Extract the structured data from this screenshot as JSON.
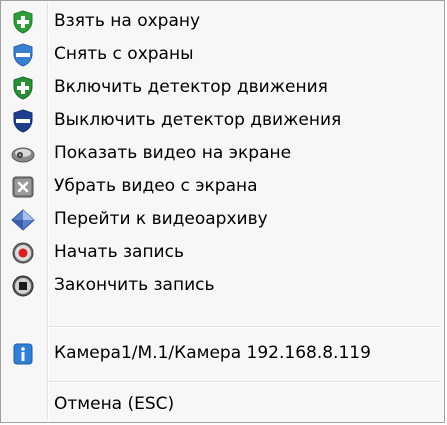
{
  "context_menu": {
    "items": [
      {
        "label": "Взять на охрану",
        "icon": "shield-green-plus-icon"
      },
      {
        "label": "Снять с охраны",
        "icon": "shield-blue-minus-icon"
      },
      {
        "label": "Включить детектор движения",
        "icon": "shield-green-plus-icon"
      },
      {
        "label": "Выключить детектор движения",
        "icon": "shield-navy-minus-icon"
      },
      {
        "label": "Показать видео на экране",
        "icon": "camera-icon"
      },
      {
        "label": "Убрать видео с экрана",
        "icon": "close-box-icon"
      },
      {
        "label": "Перейти к видеоархиву",
        "icon": "archive-diamond-icon"
      },
      {
        "label": "Начать запись",
        "icon": "record-icon"
      },
      {
        "label": "Закончить запись",
        "icon": "stop-icon"
      }
    ],
    "info_item": {
      "label": "Камера1/М.1/Камера 192.168.8.119",
      "icon": "info-icon"
    },
    "cancel_item": {
      "label": "Отмена (ESC)"
    }
  },
  "colors": {
    "shield_green": "#2e9e3a",
    "shield_blue": "#3a7fd0",
    "shield_navy": "#1e3f8f",
    "info_blue": "#2f7fd6"
  }
}
